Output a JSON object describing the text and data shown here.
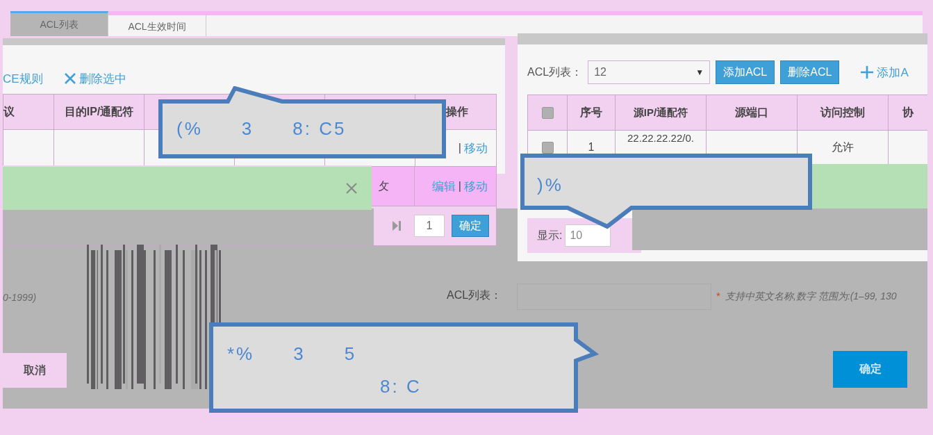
{
  "top_tabs": [
    {
      "label": "ACL列表",
      "selected": true
    },
    {
      "label": "ACL生效时间",
      "selected": false
    }
  ],
  "left_panel": {
    "toolbar": [
      {
        "kind": "link",
        "label": "CE规则"
      },
      {
        "kind": "delete",
        "label": "删除选中"
      }
    ],
    "columns": [
      "议",
      "目的IP/通配符",
      "",
      "",
      "",
      "操作"
    ],
    "rows": [
      {
        "selected": false,
        "actions": [
          {
            "kind": "separator",
            "label": "|"
          },
          {
            "kind": "link",
            "label": "移动"
          }
        ]
      },
      {
        "selected": true,
        "partial": "攵",
        "actions": [
          {
            "kind": "link",
            "label": "编辑"
          },
          {
            "kind": "separator",
            "label": "|"
          },
          {
            "kind": "link",
            "label": "移动"
          }
        ]
      }
    ],
    "page_input": "1",
    "go_button": "确定"
  },
  "right_panel": {
    "list_label": "ACL列表：",
    "select_value": "12",
    "select_caret": "▼",
    "header_checked": false,
    "buttons": [
      "添加ACL",
      "删除ACL"
    ],
    "add_link": "添加A",
    "columns": [
      "序号",
      "源IP/通配符",
      "源端口",
      "访问控制",
      "协"
    ],
    "rows": [
      {
        "checked": false,
        "cells": [
          "1",
          "22.22.22.22/0.",
          "",
          "允许",
          ""
        ]
      }
    ],
    "show_label": "显示:",
    "show_value": "10"
  },
  "dialog": {
    "hint_left": "0-1999)",
    "field_label": "ACL列表：",
    "required_mark": "*",
    "field_hint": "支持中英文名称,数字 范围为:(1–99, 130",
    "cancel": "取消",
    "confirm": "确定"
  },
  "callouts": [
    {
      "kind": "top",
      "lines": [
        [
          "(%",
          "3",
          "8: C5"
        ]
      ]
    },
    {
      "kind": "bottom",
      "lines": [
        [
          ")%"
        ]
      ]
    },
    {
      "kind": "right",
      "lines": [
        [
          "*%",
          "3",
          "5"
        ],
        [
          "8: C"
        ]
      ]
    }
  ]
}
